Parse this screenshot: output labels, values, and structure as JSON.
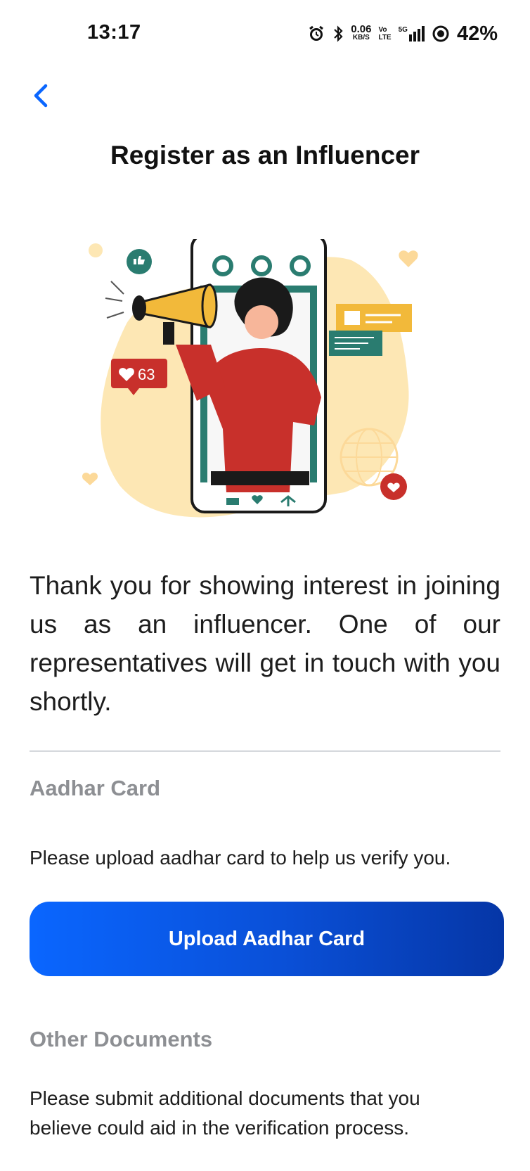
{
  "status_bar": {
    "time": "13:17",
    "net_speed_value": "0.06",
    "net_speed_unit": "KB/S",
    "volte_top": "Vo",
    "volte_bottom": "LTE",
    "network_type": "5G",
    "battery": "42%"
  },
  "header": {
    "title": "Register as an Influencer"
  },
  "illustration": {
    "likes_count": "63"
  },
  "intro": {
    "message": "Thank you for showing interest in joining us as an influencer. One of our representatives will get in touch with you shortly."
  },
  "aadhar_section": {
    "title": "Aadhar Card",
    "description": "Please upload aadhar card to help us verify you.",
    "button_label": "Upload Aadhar Card"
  },
  "other_documents_section": {
    "title": "Other Documents",
    "description": "Please submit additional documents that you believe could aid in the verification process."
  },
  "colors": {
    "accent": "#0a66ff",
    "button_gradient_end": "#0536a6",
    "section_title": "#8d8f93",
    "illustration_teal": "#2a7c70",
    "illustration_red": "#c8302b",
    "illustration_yellow": "#f2b93a",
    "illustration_blob": "#fde7b4"
  }
}
